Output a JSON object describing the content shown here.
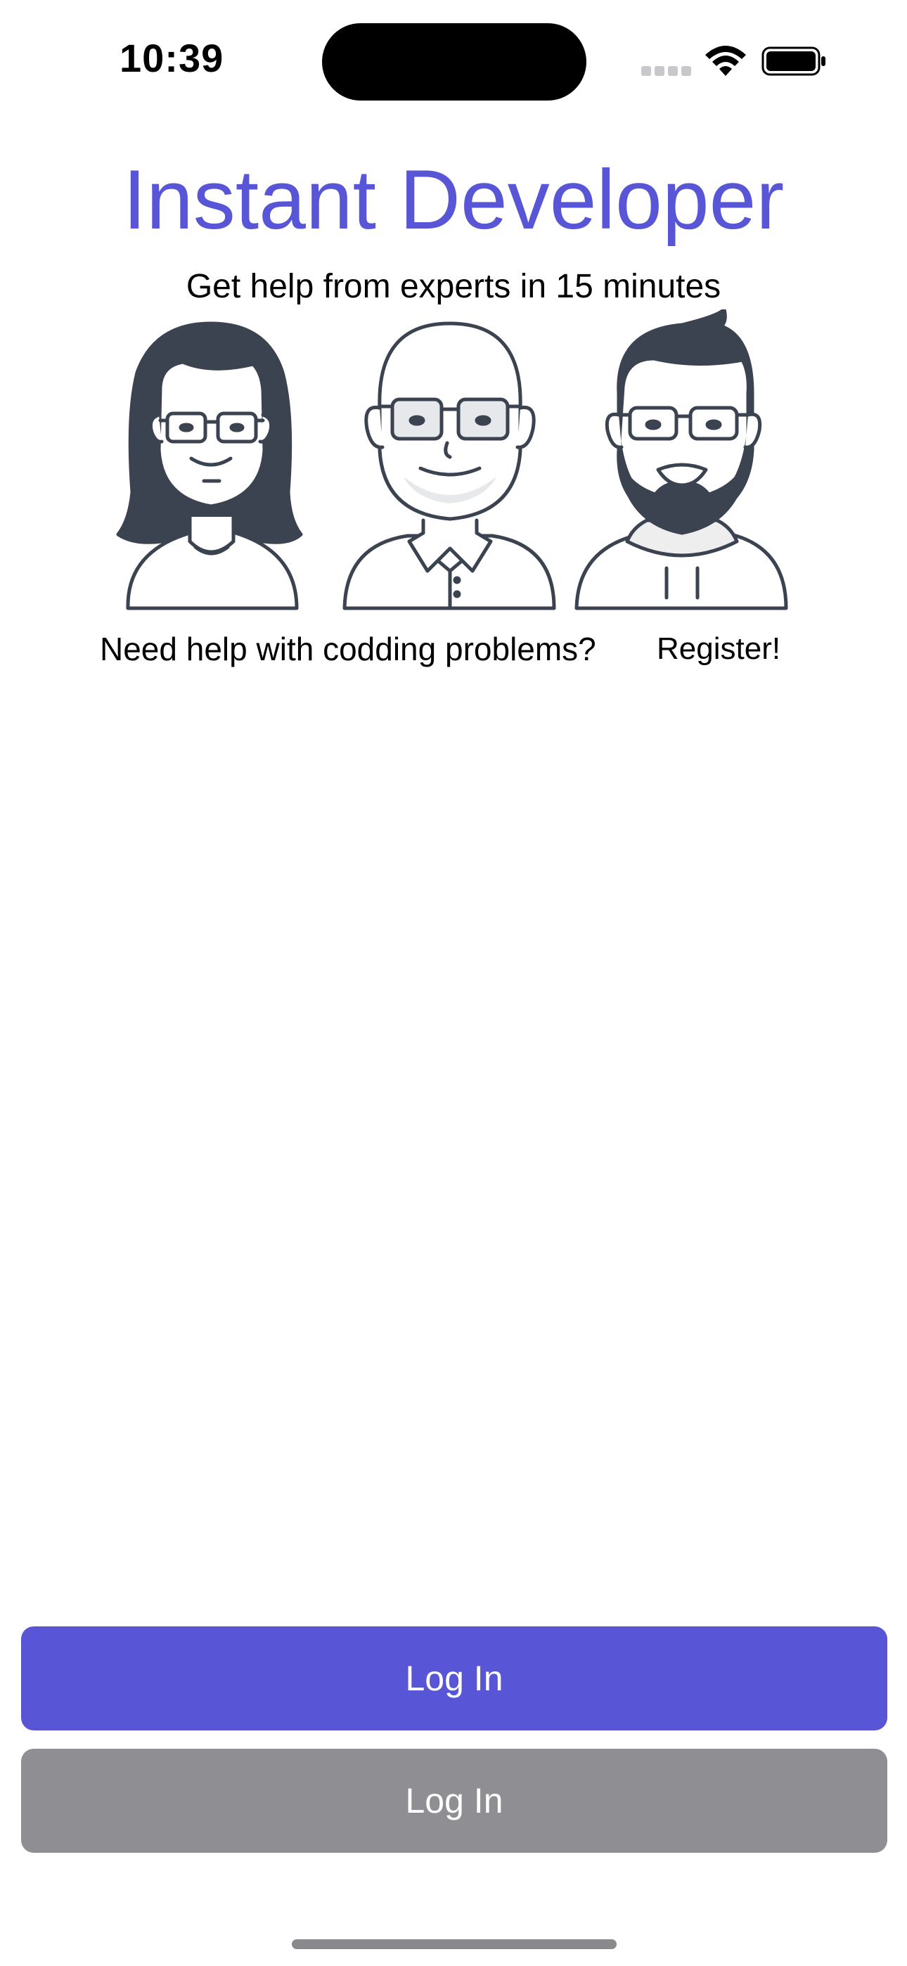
{
  "status_bar": {
    "time": "10:39"
  },
  "header": {
    "title": "Instant Developer",
    "subtitle": "Get help from experts in 15 minutes"
  },
  "illustration": {
    "avatars": [
      "woman-with-glasses-avatar",
      "bald-man-with-glasses-avatar",
      "bearded-man-with-glasses-avatar"
    ]
  },
  "prompt": {
    "text": "Need help with codding problems?",
    "register_label": "Register!"
  },
  "actions": {
    "primary_label": "Log In",
    "secondary_label": "Log In"
  },
  "colors": {
    "accent": "#5856d6",
    "secondary_button": "#8e8e93",
    "illustration_stroke": "#3c4350"
  }
}
